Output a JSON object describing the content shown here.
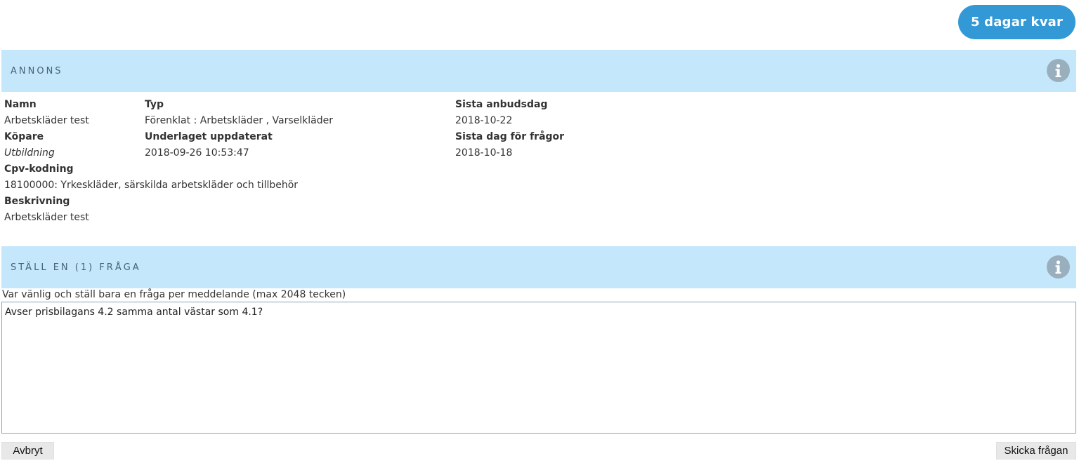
{
  "badge": {
    "days_left": "5 dagar kvar"
  },
  "annons": {
    "header": "ANNONS",
    "info_icon": "info-icon",
    "fields": {
      "namn": {
        "label": "Namn",
        "value": "Arbetskläder test"
      },
      "typ": {
        "label": "Typ",
        "value": "Förenklat : Arbetskläder , Varselkläder"
      },
      "sista_anbudsdag": {
        "label": "Sista anbudsdag",
        "value": "2018-10-22"
      },
      "kopare": {
        "label": "Köpare",
        "value": "Utbildning"
      },
      "underlaget": {
        "label": "Underlaget uppdaterat",
        "value": "2018-09-26 10:53:47"
      },
      "sista_fragor": {
        "label": "Sista dag för frågor",
        "value": "2018-10-18"
      },
      "cpv": {
        "label": "Cpv-kodning",
        "value": "18100000: Yrkeskläder, särskilda arbetskläder och tillbehör"
      },
      "beskrivning": {
        "label": "Beskrivning",
        "value": "Arbetskläder test"
      }
    }
  },
  "fraga": {
    "header": "STÄLL EN (1) FRÅGA",
    "info_icon": "info-icon",
    "hint": "Var vänlig och ställ bara en fråga per meddelande (max 2048 tecken)",
    "question_value": "Avser prisbilagans 4.2 samma antal västar som 4.1?"
  },
  "buttons": {
    "cancel": "Avbryt",
    "send": "Skicka frågan"
  },
  "colors": {
    "accent": "#3399d6",
    "section_bg": "#c4e7fb",
    "info_icon": "#9aafbd"
  }
}
